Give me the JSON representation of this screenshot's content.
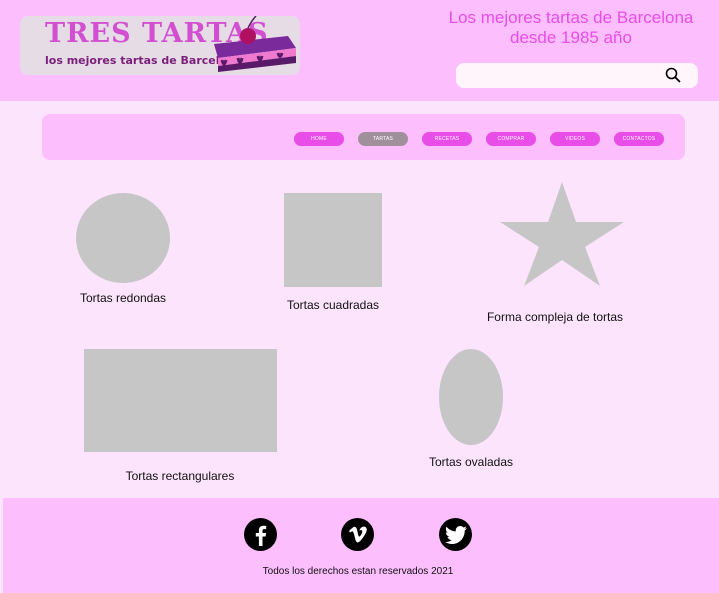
{
  "header": {
    "logo_title": "TRES TARTAS",
    "logo_subtitle": "los mejores tartas de Barcelona",
    "tagline_line1": "Los mejores tartas de Barcelona",
    "tagline_line2": "desde 1985 año",
    "search_placeholder": "",
    "search_icon": "search-icon"
  },
  "nav": {
    "items": [
      {
        "label": "HOME"
      },
      {
        "label": "TARTAS"
      },
      {
        "label": "RECETAS"
      },
      {
        "label": "COMPRAR"
      },
      {
        "label": "VIDEOS"
      },
      {
        "label": "CONTACTOS"
      }
    ],
    "active_index": 1
  },
  "products": [
    {
      "label": "Tortas redondas",
      "shape": "circle"
    },
    {
      "label": "Tortas cuadradas",
      "shape": "square"
    },
    {
      "label": "Forma compleja de tortas",
      "shape": "star"
    },
    {
      "label": "Tortas rectangulares",
      "shape": "rectangle"
    },
    {
      "label": "Tortas ovaladas",
      "shape": "oval"
    }
  ],
  "footer": {
    "social": [
      "facebook-icon",
      "vimeo-icon",
      "twitter-icon"
    ],
    "copyright": "Todos los derechos estan reservados 2021"
  },
  "colors": {
    "header_bg": "#fdbefd",
    "page_bg": "#fce4fc",
    "accent": "#e84de8",
    "active_nav": "#a0909c",
    "placeholder_shape": "#c6c6c6"
  }
}
